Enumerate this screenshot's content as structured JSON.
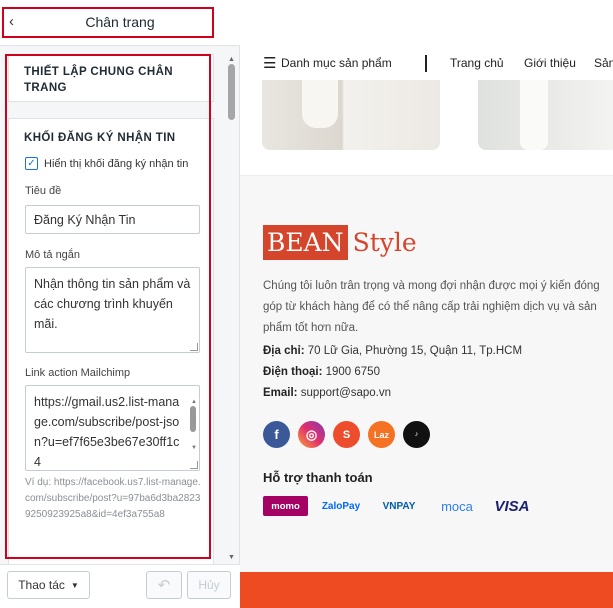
{
  "panel": {
    "header_title": "Chân trang",
    "back_glyph": "‹",
    "section1_title": "THIẾT LẬP CHUNG CHÂN TRANG",
    "section2_title": "KHỐI ĐĂNG KÝ NHẬN TIN",
    "checkbox_label": "Hiển thị khối đăng ký nhận tin",
    "checkbox_checked": true,
    "title_label": "Tiêu đề",
    "title_value": "Đăng Ký Nhận Tin",
    "short_desc_label": "Mô tả ngắn",
    "short_desc_value": "Nhận thông tin sản phẩm và các chương trình khuyến mãi.",
    "mailchimp_label": "Link action Mailchimp",
    "mailchimp_value": "https://gmail.us2.list-manage.com/subscribe/post-json?u=ef7f65e3be67e30ff1c4",
    "mailchimp_example": "Ví dụ: https://facebook.us7.list-manage.com/subscribe/post?u=97ba6d3ba28239250923925a8&id=4ef3a755a8",
    "actions_button": "Thao tác",
    "undo_button": "↶",
    "cancel_button": "Hủy"
  },
  "preview": {
    "nav": {
      "category": "Danh mục sản phẩm",
      "links": [
        "Trang chủ",
        "Giới thiệu",
        "Sản"
      ]
    },
    "footer": {
      "logo_box": "BEAN",
      "logo_text": "Style",
      "description": "Chúng tôi luôn trân trọng và mong đợi nhận được mọi ý kiến đóng góp từ khách hàng để có thể nâng cấp trải nghiệm dịch vụ và sản phẩm tốt hơn nữa.",
      "address_label": "Địa chỉ:",
      "address_value": " 70 Lữ Gia, Phường 15, Quận 11, Tp.HCM",
      "phone_label": "Điện thoại:",
      "phone_value": " 1900 6750",
      "email_label": "Email:",
      "email_value": " support@sapo.vn",
      "socials": [
        "facebook-icon",
        "instagram-icon",
        "shopee-icon",
        "lazada-icon",
        "tiktok-icon"
      ],
      "payment_title": "Hỗ trợ thanh toán",
      "payments": [
        "momo",
        "ZaloPay",
        "VNPAY",
        "moca",
        "VISA"
      ]
    },
    "accent_color": "#ef4b23",
    "brand_color": "#d5452b"
  }
}
